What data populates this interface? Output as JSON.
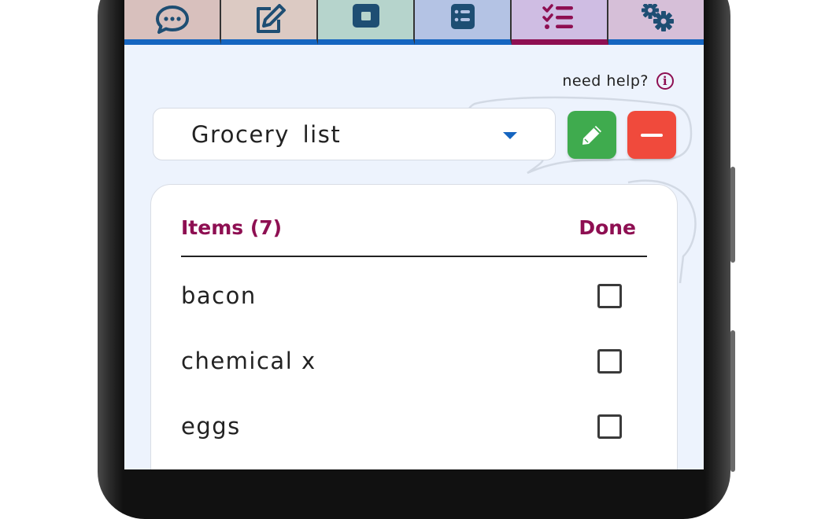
{
  "tabs": [
    {
      "name": "tab-chat",
      "icon": "chat-bubble-icon",
      "bg": "#d8c0bd",
      "active": false
    },
    {
      "name": "tab-edit",
      "icon": "edit-note-icon",
      "bg": "#dccac3",
      "active": false
    },
    {
      "name": "tab-save",
      "icon": "save-square-icon",
      "bg": "#b6d4cc",
      "active": false
    },
    {
      "name": "tab-list",
      "icon": "list-document-icon",
      "bg": "#b4c3e4",
      "active": false
    },
    {
      "name": "tab-checklist",
      "icon": "checklist-icon",
      "bg": "#cfbde3",
      "active": true
    },
    {
      "name": "tab-settings",
      "icon": "gears-icon",
      "bg": "#d6bfd8",
      "active": false
    }
  ],
  "help": {
    "label": "need help?",
    "icon": "info-icon",
    "icon_text": "i"
  },
  "list_select": {
    "value": "Grocery  list",
    "icon": "caret-down-icon"
  },
  "actions": {
    "edit_icon": "pencil-icon",
    "remove_icon": "minus-icon"
  },
  "table": {
    "items_header": "Items (7)",
    "done_header": "Done",
    "rows": [
      {
        "label": "bacon",
        "done": false
      },
      {
        "label": "chemical x",
        "done": false
      },
      {
        "label": "eggs",
        "done": false
      }
    ]
  },
  "colors": {
    "accent": "#8e0f52",
    "primary_blue": "#1565c0",
    "edit_green": "#3fab4e",
    "remove_red": "#f04a3c",
    "screen_bg": "#edf3fd"
  }
}
